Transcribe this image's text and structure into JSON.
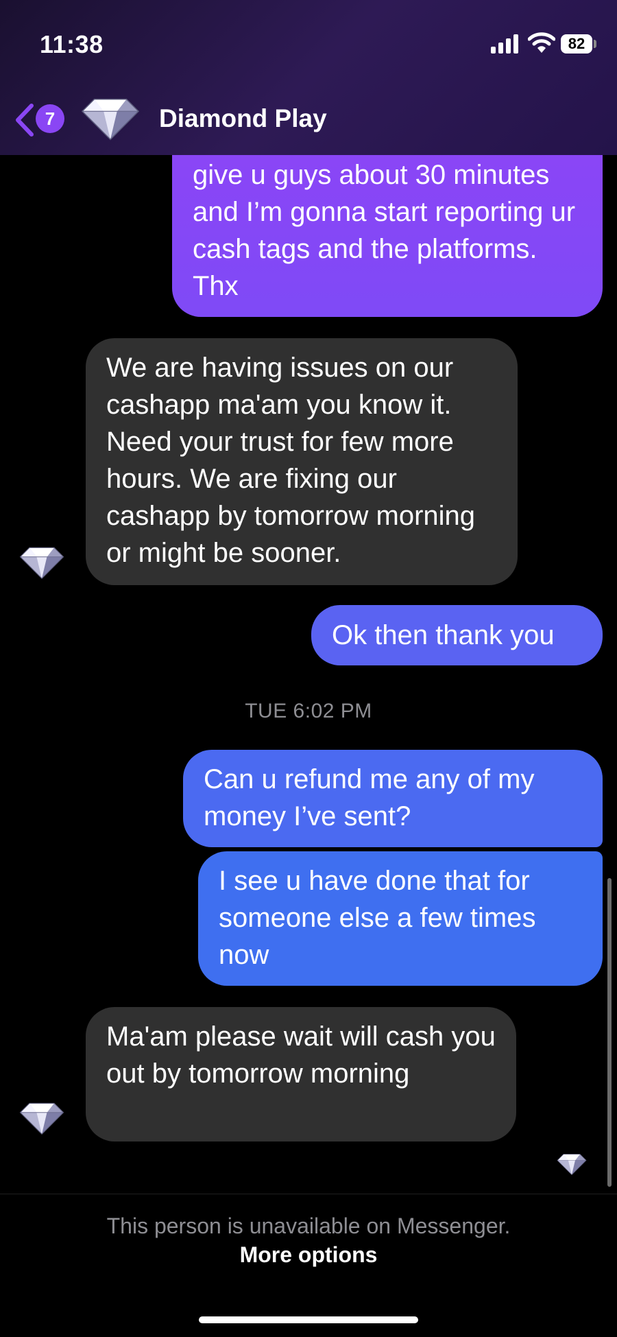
{
  "status_bar": {
    "time": "11:38",
    "battery": "82"
  },
  "header": {
    "back_badge_count": "7",
    "contact_name": "Diamond Play"
  },
  "messages": [
    {
      "sender": "me",
      "text": "give u guys about 30 minutes and I’m gonna start reporting ur cash tags and the platforms. Thx"
    },
    {
      "sender": "them",
      "text": "We are having issues on our cashapp ma'am you know it. Need your trust for few more hours. We are fixing our cashapp by tomorrow morning or might be sooner."
    },
    {
      "sender": "me",
      "text": "Ok then thank you"
    },
    {
      "sender": "me",
      "text": "Can u refund me any of my money I’ve sent?"
    },
    {
      "sender": "me",
      "text": "I see u have done that for someone else a few times now"
    },
    {
      "sender": "them",
      "text": "Ma'am please wait will cash you out by tomorrow morning"
    }
  ],
  "timestamp": "TUE 6:02 PM",
  "footer": {
    "unavailable_text": "This person is unavailable on Messenger.",
    "more_options_label": "More options"
  },
  "colors": {
    "outgoing_top": "#8b45f6",
    "outgoing_mid": "#5a63f2",
    "outgoing_bottom": "#3f6ff0",
    "incoming": "#303030",
    "accent": "#8a46f4"
  },
  "icons": {
    "back": "chevron-left-icon",
    "avatar": "diamond-icon",
    "signal": "cellular-signal-icon",
    "wifi": "wifi-icon",
    "battery": "battery-icon"
  }
}
